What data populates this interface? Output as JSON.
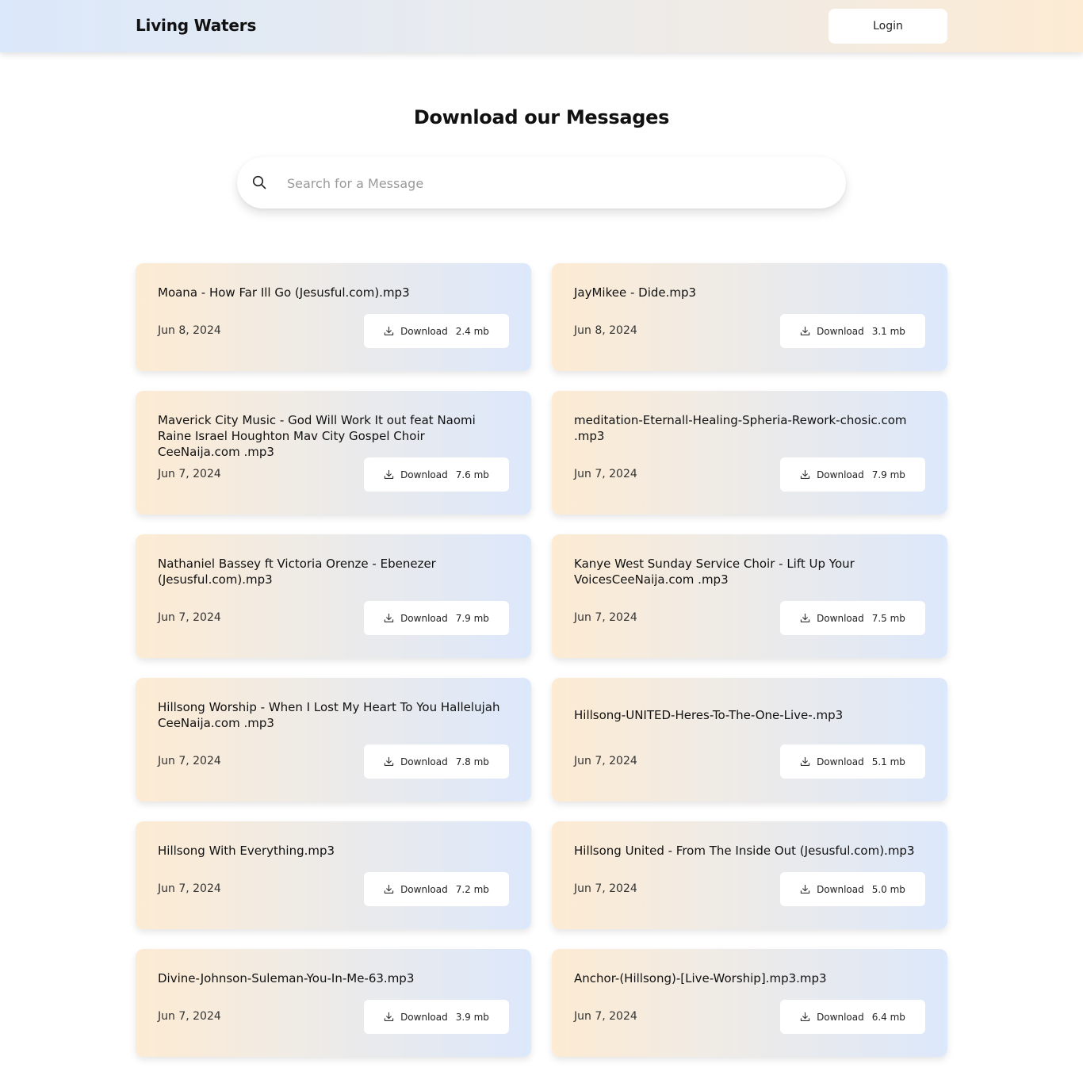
{
  "header": {
    "brand": "Living Waters",
    "login_label": "Login"
  },
  "page_title": "Download our Messages",
  "search": {
    "placeholder": "Search for a Message",
    "value": ""
  },
  "download_label": "Download",
  "messages": [
    {
      "title": "Moana - How Far Ill Go (Jesusful.com).mp3",
      "date": "Jun 8, 2024",
      "size": "2.4 mb"
    },
    {
      "title": "JayMikee - Dide.mp3",
      "date": "Jun 8, 2024",
      "size": "3.1 mb"
    },
    {
      "title": "Maverick City Music - God Will Work It out feat Naomi Raine Israel Houghton Mav City Gospel Choir CeeNaija.com .mp3",
      "date": "Jun 7, 2024",
      "size": "7.6 mb"
    },
    {
      "title": "meditation-Eternall-Healing-Spheria-Rework-chosic.com .mp3",
      "date": "Jun 7, 2024",
      "size": "7.9 mb"
    },
    {
      "title": "Nathaniel Bassey ft Victoria Orenze - Ebenezer (Jesusful.com).mp3",
      "date": "Jun 7, 2024",
      "size": "7.9 mb"
    },
    {
      "title": "Kanye West Sunday Service Choir - Lift Up Your VoicesCeeNaija.com .mp3",
      "date": "Jun 7, 2024",
      "size": "7.5 mb"
    },
    {
      "title": "Hillsong Worship - When I Lost My Heart To You Hallelujah CeeNaija.com .mp3",
      "date": "Jun 7, 2024",
      "size": "7.8 mb"
    },
    {
      "title": "Hillsong-UNITED-Heres-To-The-One-Live-.mp3",
      "date": "Jun 7, 2024",
      "size": "5.1 mb"
    },
    {
      "title": "Hillsong With Everything.mp3",
      "date": "Jun 7, 2024",
      "size": "7.2 mb"
    },
    {
      "title": "Hillsong United - From The Inside Out (Jesusful.com).mp3",
      "date": "Jun 7, 2024",
      "size": "5.0 mb"
    },
    {
      "title": "Divine-Johnson-Suleman-You-In-Me-63.mp3",
      "date": "Jun 7, 2024",
      "size": "3.9 mb"
    },
    {
      "title": "Anchor-(Hillsong)-[Live-Worship].mp3.mp3",
      "date": "Jun 7, 2024",
      "size": "6.4 mb"
    }
  ]
}
